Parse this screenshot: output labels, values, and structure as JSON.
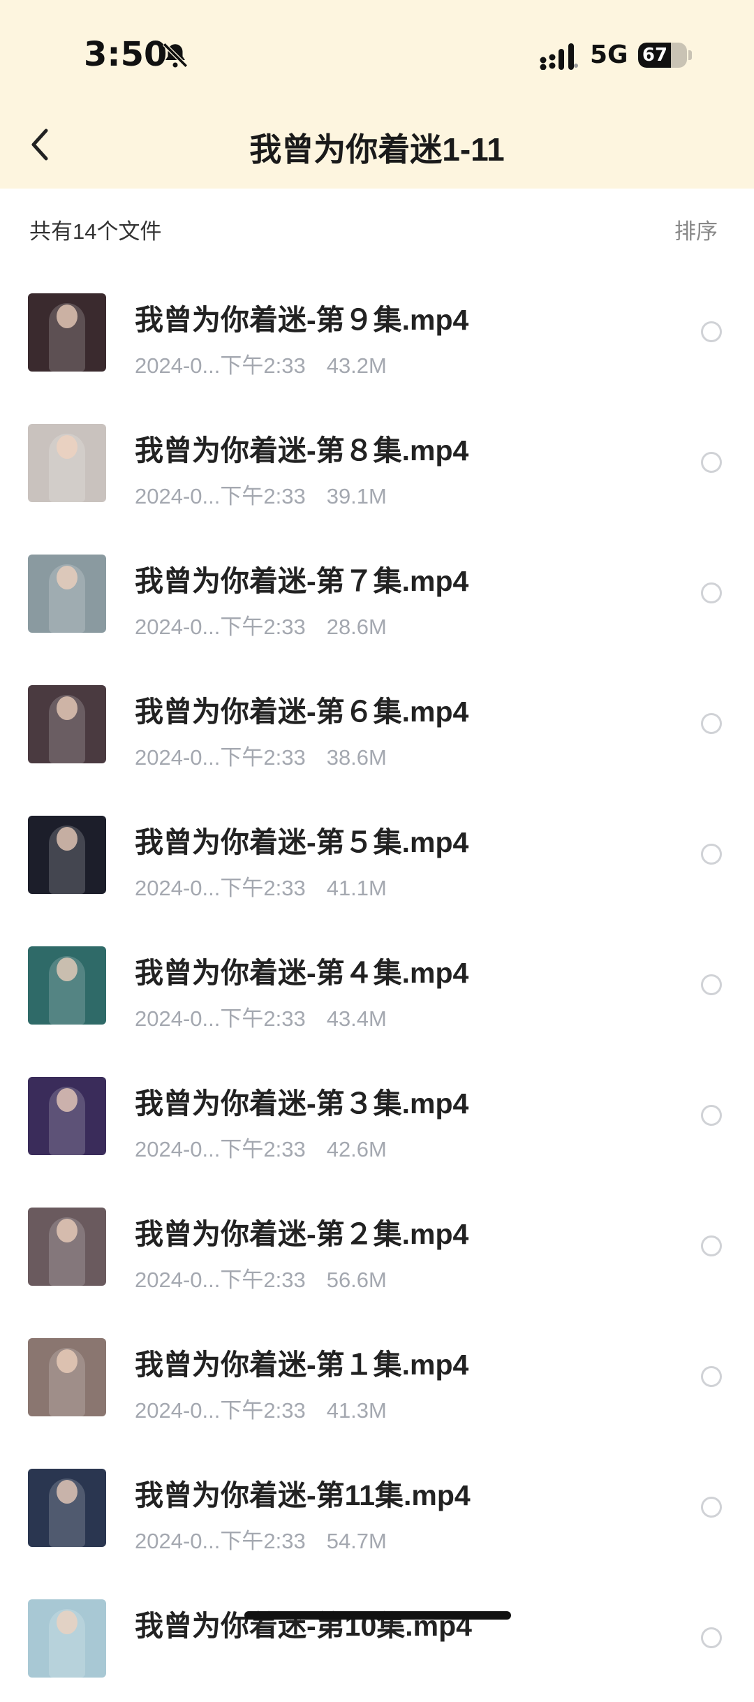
{
  "status_bar": {
    "time": "3:50",
    "network": "5G",
    "battery": "67",
    "battery_level": 0.67
  },
  "header": {
    "title": "我曾为你着迷1-11"
  },
  "toolbar": {
    "file_count": "共有14个文件",
    "sort_label": "排序"
  },
  "files": [
    {
      "name": "我曾为你着迷-第９集.mp4",
      "date": "2024-0...下午2:33",
      "size": "43.2M",
      "thumb_color": "#3a2a2e"
    },
    {
      "name": "我曾为你着迷-第８集.mp4",
      "date": "2024-0...下午2:33",
      "size": "39.1M",
      "thumb_color": "#c9c2be"
    },
    {
      "name": "我曾为你着迷-第７集.mp4",
      "date": "2024-0...下午2:33",
      "size": "28.6M",
      "thumb_color": "#8a9aa0"
    },
    {
      "name": "我曾为你着迷-第６集.mp4",
      "date": "2024-0...下午2:33",
      "size": "38.6M",
      "thumb_color": "#4a3a40"
    },
    {
      "name": "我曾为你着迷-第５集.mp4",
      "date": "2024-0...下午2:33",
      "size": "41.1M",
      "thumb_color": "#1c1e2a"
    },
    {
      "name": "我曾为你着迷-第４集.mp4",
      "date": "2024-0...下午2:33",
      "size": "43.4M",
      "thumb_color": "#2f6a68"
    },
    {
      "name": "我曾为你着迷-第３集.mp4",
      "date": "2024-0...下午2:33",
      "size": "42.6M",
      "thumb_color": "#3a2c5a"
    },
    {
      "name": "我曾为你着迷-第２集.mp4",
      "date": "2024-0...下午2:33",
      "size": "56.6M",
      "thumb_color": "#6a5a5e"
    },
    {
      "name": "我曾为你着迷-第１集.mp4",
      "date": "2024-0...下午2:33",
      "size": "41.3M",
      "thumb_color": "#8a7670"
    },
    {
      "name": "我曾为你着迷-第11集.mp4",
      "date": "2024-0...下午2:33",
      "size": "54.7M",
      "thumb_color": "#2a3650"
    },
    {
      "name": "我曾为你着迷-第10集.mp4",
      "date": "",
      "size": "",
      "thumb_color": "#a8c8d4"
    }
  ]
}
